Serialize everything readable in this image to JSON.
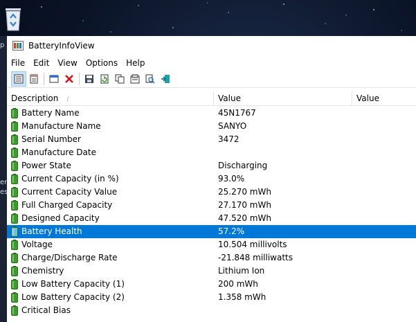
{
  "window": {
    "title": "BatteryInfoView"
  },
  "menu": [
    "File",
    "Edit",
    "View",
    "Options",
    "Help"
  ],
  "toolbar": [
    "report-view-icon",
    "html-report-icon",
    "properties-icon",
    "delete-icon",
    "save-icon",
    "refresh-icon",
    "copy-icon",
    "options-icon",
    "find-icon",
    "exit-icon"
  ],
  "columns": {
    "description": "Description",
    "value": "Value",
    "value2": "Value"
  },
  "rows": [
    {
      "description": "Battery Name",
      "value": "45N1767"
    },
    {
      "description": "Manufacture Name",
      "value": "SANYO"
    },
    {
      "description": "Serial Number",
      "value": " 3472"
    },
    {
      "description": "Manufacture Date",
      "value": ""
    },
    {
      "description": "Power State",
      "value": "Discharging"
    },
    {
      "description": "Current Capacity (in %)",
      "value": "93.0%"
    },
    {
      "description": "Current Capacity Value",
      "value": "25.270 mWh"
    },
    {
      "description": "Full Charged Capacity",
      "value": "27.170 mWh"
    },
    {
      "description": "Designed Capacity",
      "value": "47.520 mWh"
    },
    {
      "description": "Battery Health",
      "value": "57.2%",
      "selected": true
    },
    {
      "description": "Voltage",
      "value": "10.504 millivolts"
    },
    {
      "description": "Charge/Discharge Rate",
      "value": "-21.848 milliwatts"
    },
    {
      "description": "Chemistry",
      "value": "Lithium Ion"
    },
    {
      "description": "Low Battery Capacity (1)",
      "value": "200 mWh"
    },
    {
      "description": "Low Battery Capacity (2)",
      "value": "1.358 mWh"
    },
    {
      "description": "Critical Bias",
      "value": ""
    }
  ],
  "desktop": {
    "strip_labels": [
      "p",
      "er",
      "es"
    ]
  },
  "colors": {
    "selection": "#0078d7",
    "battery_green": "#3a9e2a"
  }
}
